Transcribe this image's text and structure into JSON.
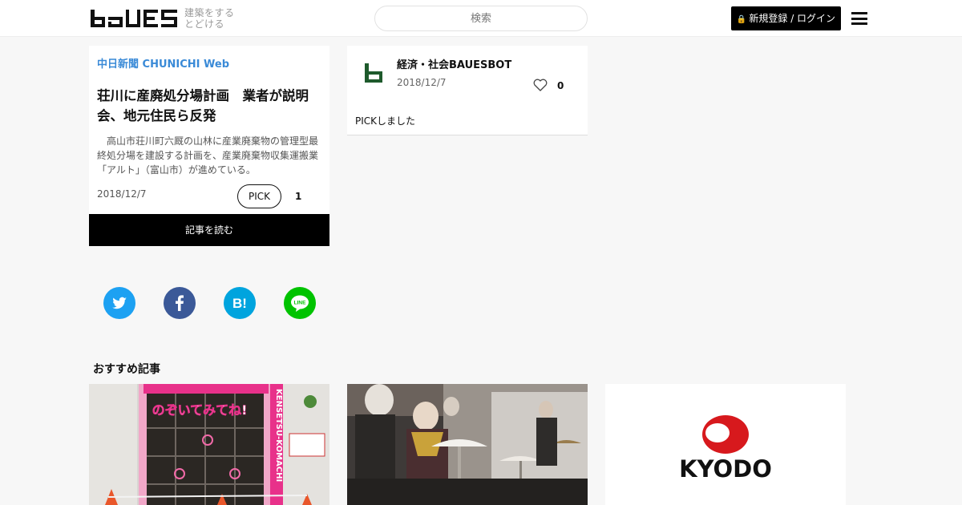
{
  "header": {
    "tagline_line1": "建築をする",
    "tagline_line2": "とどける",
    "search_placeholder": "検索",
    "login_label": "新規登録 / ログイン",
    "logo_icon": "bauhaus-wordmark-icon",
    "menu_icon": "hamburger-icon"
  },
  "article": {
    "source": "中日新聞 CHUNICHI Web",
    "title": "荘川に産廃処分場計画　業者が説明会、地元住民ら反発",
    "excerpt": "　高山市荘川町六厩の山林に産業廃棄物の管理型最終処分場を建設する計画を、産業廃棄物収集運搬業「アルト」（富山市）が進めている。",
    "date": "2018/12/7",
    "pick_label": "PICK",
    "pick_count": "1",
    "read_label": "記事を読む"
  },
  "pick": {
    "user": "経済・社会BAUESBOT",
    "date": "2018/12/7",
    "likes": "0",
    "comment": "PICKしました"
  },
  "share": {
    "twitter_icon": "twitter-icon",
    "facebook_icon": "facebook-icon",
    "hatena_icon": "hatena-bookmark-icon",
    "hatena_text": "B!",
    "line_icon": "line-icon",
    "line_text": "LINE"
  },
  "recommended": {
    "title": "おすすめ記事",
    "thumb1_text": "のぞいてみてね!",
    "thumb1_side": "KENSETSU-KOMACHI",
    "thumb3_text": "KYODO"
  },
  "colors": {
    "source_blue": "#3a8ad7",
    "twitter": "#1da1f2",
    "facebook": "#3b5998",
    "hatena": "#00a4de",
    "line": "#00c300",
    "kyodo_red": "#d7191d"
  }
}
